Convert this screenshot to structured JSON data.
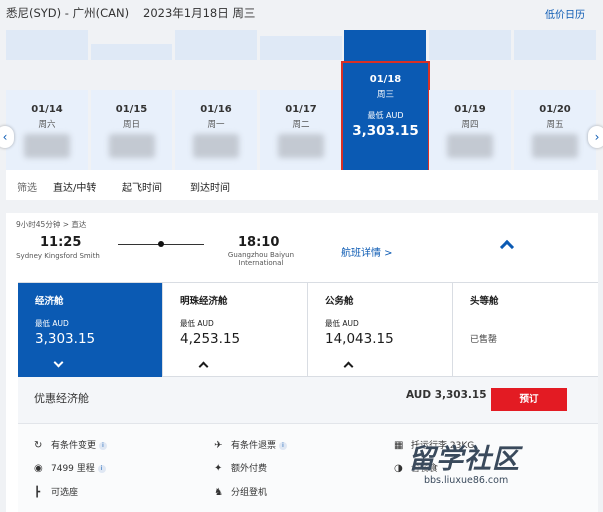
{
  "header": {
    "route": "悉尼(SYD) - 广州(CAN)",
    "date": "2023年1月18日 周三",
    "low_calendar": "低价日历"
  },
  "dates": [
    {
      "date": "01/14",
      "weekday": "周六"
    },
    {
      "date": "01/15",
      "weekday": "周日"
    },
    {
      "date": "01/16",
      "weekday": "周一"
    },
    {
      "date": "01/17",
      "weekday": "周二"
    },
    {
      "date": "01/18",
      "weekday": "周三",
      "price_label": "最低 AUD",
      "price": "3,303.15"
    },
    {
      "date": "01/19",
      "weekday": "周四"
    },
    {
      "date": "01/20",
      "weekday": "周五"
    }
  ],
  "filter": {
    "label": "筛选",
    "items": [
      "直达/中转",
      "起飞时间",
      "到达时间"
    ]
  },
  "flight": {
    "duration": "9小时45分钟 > 直达",
    "depart_time": "11:25",
    "depart_airport": "Sydney Kingsford Smith",
    "arrive_time": "18:10",
    "arrive_airport_1": "Guangzhou Baiyun",
    "arrive_airport_2": "International",
    "details_link": "航班详情 >"
  },
  "cabins": [
    {
      "name": "经济舱",
      "label": "最低 AUD",
      "price": "3,303.15"
    },
    {
      "name": "明珠经济舱",
      "label": "最低 AUD",
      "price": "4,253.15"
    },
    {
      "name": "公务舱",
      "label": "最低 AUD",
      "price": "14,043.15"
    },
    {
      "name": "头等舱",
      "status": "已售罄"
    }
  ],
  "fare": {
    "name": "优惠经济舱",
    "price": "AUD 3,303.15",
    "book": "预订",
    "features": [
      {
        "icon": "refresh-icon",
        "text": "有条件变更",
        "info": "i"
      },
      {
        "icon": "plane-refund-icon",
        "text": "有条件退票",
        "info": "i"
      },
      {
        "icon": "luggage-icon",
        "text": "托运行李 23KG"
      },
      {
        "icon": "coins-icon",
        "text": "7499 里程",
        "info": "i"
      },
      {
        "icon": "fork-icon",
        "text": "额外付费"
      },
      {
        "icon": "meal-icon",
        "text": "含餐食"
      },
      {
        "icon": "seat-icon",
        "text": "可选座"
      },
      {
        "icon": "group-icon",
        "text": "分组登机"
      }
    ]
  },
  "watermark": {
    "text": "留学社区",
    "url": "bbs.liuxue86.com"
  },
  "colors": {
    "brand_blue": "#0b5ab3",
    "book_red": "#e31b23",
    "selected_border": "#d93025"
  }
}
